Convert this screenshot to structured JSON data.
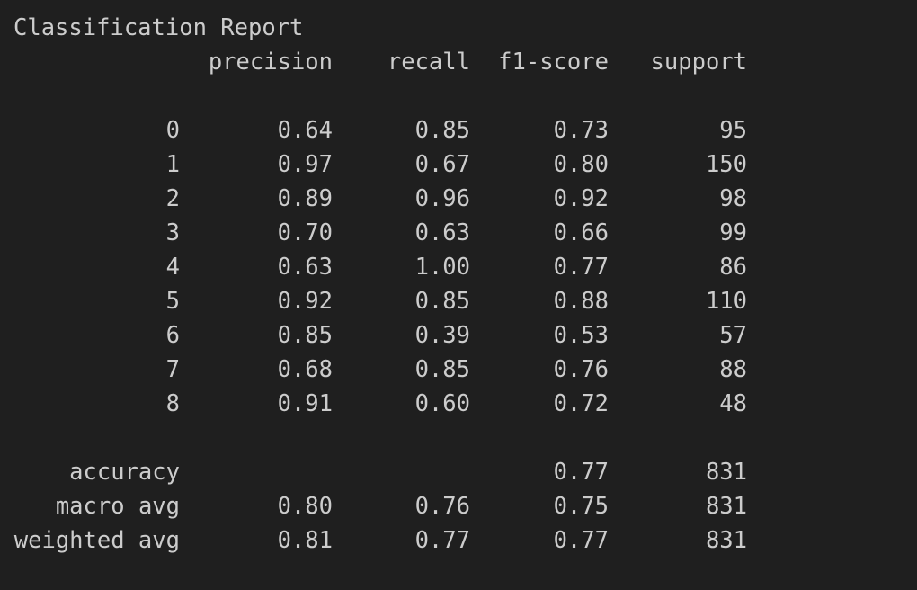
{
  "report": {
    "title": "Classification Report",
    "headers": {
      "precision": "precision",
      "recall": "recall",
      "f1": "f1-score",
      "support": "support"
    },
    "rows": [
      {
        "label": "0",
        "precision": "0.64",
        "recall": "0.85",
        "f1": "0.73",
        "support": "95"
      },
      {
        "label": "1",
        "precision": "0.97",
        "recall": "0.67",
        "f1": "0.80",
        "support": "150"
      },
      {
        "label": "2",
        "precision": "0.89",
        "recall": "0.96",
        "f1": "0.92",
        "support": "98"
      },
      {
        "label": "3",
        "precision": "0.70",
        "recall": "0.63",
        "f1": "0.66",
        "support": "99"
      },
      {
        "label": "4",
        "precision": "0.63",
        "recall": "1.00",
        "f1": "0.77",
        "support": "86"
      },
      {
        "label": "5",
        "precision": "0.92",
        "recall": "0.85",
        "f1": "0.88",
        "support": "110"
      },
      {
        "label": "6",
        "precision": "0.85",
        "recall": "0.39",
        "f1": "0.53",
        "support": "57"
      },
      {
        "label": "7",
        "precision": "0.68",
        "recall": "0.85",
        "f1": "0.76",
        "support": "88"
      },
      {
        "label": "8",
        "precision": "0.91",
        "recall": "0.60",
        "f1": "0.72",
        "support": "48"
      }
    ],
    "summary": [
      {
        "label": "accuracy",
        "precision": "",
        "recall": "",
        "f1": "0.77",
        "support": "831"
      },
      {
        "label": "macro avg",
        "precision": "0.80",
        "recall": "0.76",
        "f1": "0.75",
        "support": "831"
      },
      {
        "label": "weighted avg",
        "precision": "0.81",
        "recall": "0.77",
        "f1": "0.77",
        "support": "831"
      }
    ]
  },
  "colors": {
    "background": "#1f1f1f",
    "text": "#cccccc"
  }
}
